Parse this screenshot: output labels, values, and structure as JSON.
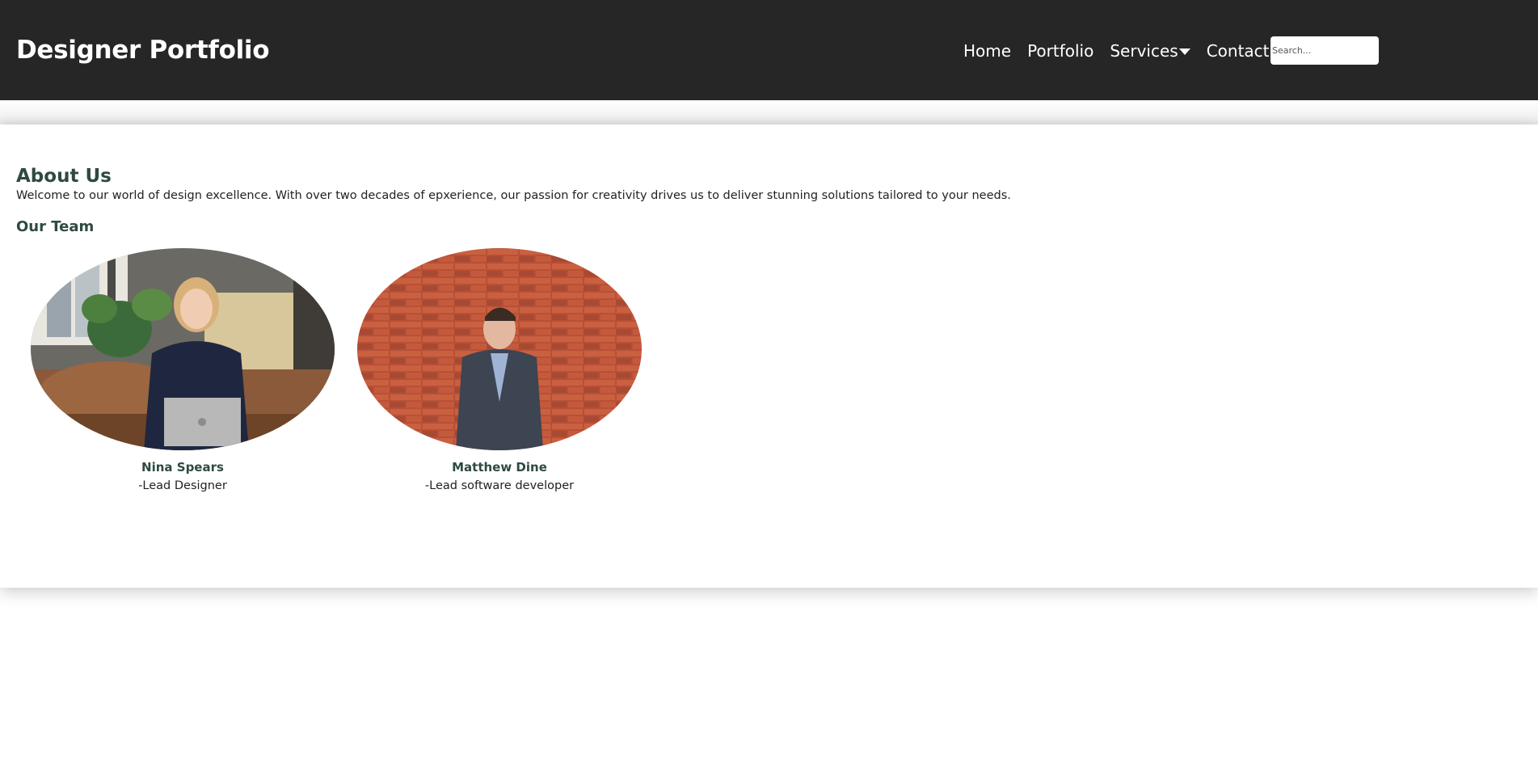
{
  "header": {
    "brand": "Designer Portfolio",
    "nav": [
      {
        "label": "Home"
      },
      {
        "label": "Portfolio"
      },
      {
        "label": "Services"
      },
      {
        "label": "Contact"
      }
    ],
    "search": {
      "placeholder": "Search...",
      "value": ""
    }
  },
  "about": {
    "title": "About Us",
    "text": "Welcome to our world of design excellence. With over two decades of epxerience, our passion for creativity drives us to deliver stunning solutions tailored to your needs."
  },
  "team": {
    "title": "Our Team",
    "members": [
      {
        "name": "Nina Spears",
        "role": "-Lead Designer"
      },
      {
        "name": "Matthew Dine",
        "role": "-Lead software developer"
      }
    ]
  },
  "colors": {
    "header_bg": "#262626",
    "accent": "#2e4a42",
    "text": "#222222"
  }
}
